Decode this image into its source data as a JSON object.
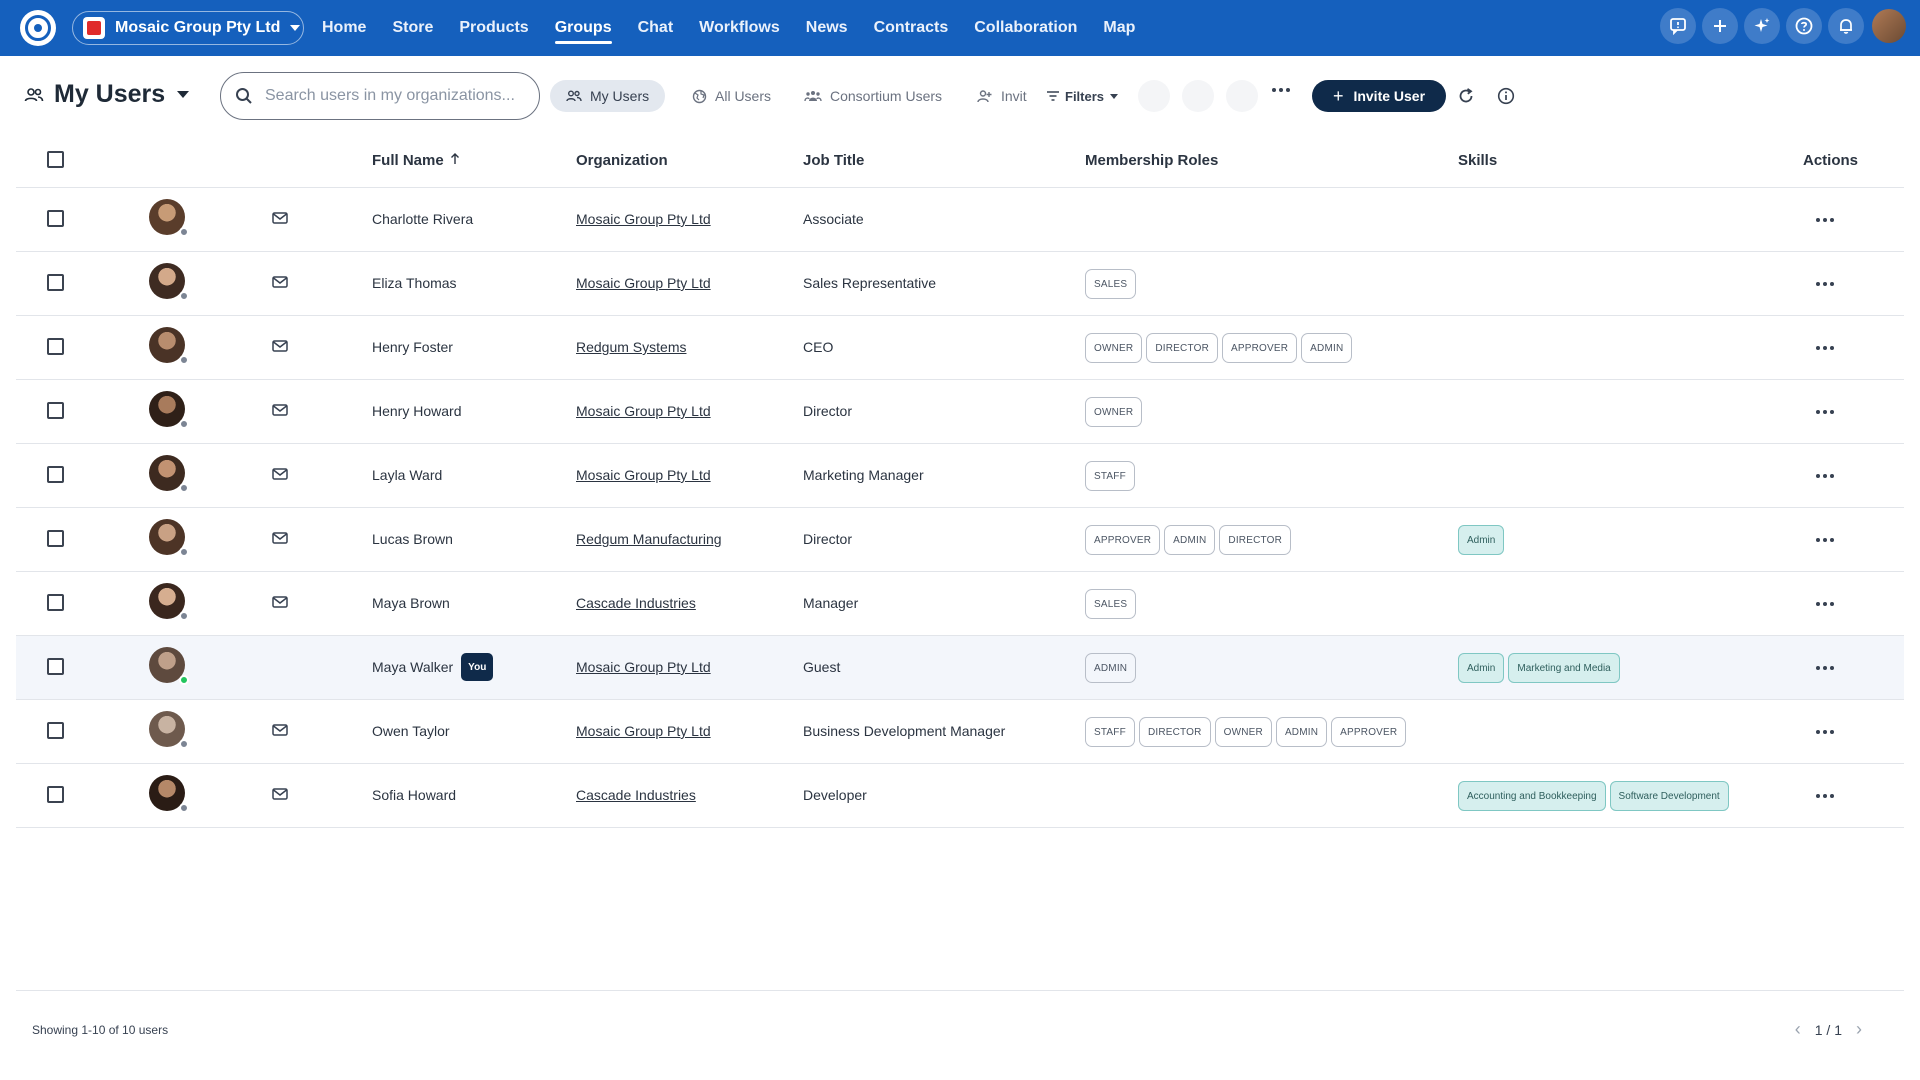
{
  "topbar": {
    "org_name": "Mosaic Group Pty Ltd",
    "nav": [
      "Home",
      "Store",
      "Products",
      "Groups",
      "Chat",
      "Workflows",
      "News",
      "Contracts",
      "Collaboration",
      "Map"
    ],
    "active_nav": "Groups",
    "icons": [
      "feedback-icon",
      "plus-icon",
      "sparkle-icon",
      "help-icon",
      "bell-icon"
    ]
  },
  "toolbar": {
    "title": "My Users",
    "search_placeholder": "Search users in my organizations...",
    "segments": {
      "my_users": "My Users",
      "all_users": "All Users",
      "consortium_users": "Consortium Users",
      "invites": "Invit"
    },
    "filters_label": "Filters",
    "invite_label": "Invite User"
  },
  "table": {
    "headers": {
      "full_name": "Full Name",
      "organization": "Organization",
      "job_title": "Job Title",
      "membership_roles": "Membership Roles",
      "skills": "Skills",
      "actions": "Actions"
    },
    "rows": [
      {
        "name": "Charlotte Rivera",
        "org": "Mosaic Group Pty Ltd",
        "job": "Associate",
        "roles": [],
        "skills": [],
        "you": false,
        "online": false,
        "mail": true
      },
      {
        "name": "Eliza Thomas",
        "org": "Mosaic Group Pty Ltd",
        "job": "Sales Representative",
        "roles": [
          "SALES"
        ],
        "skills": [],
        "you": false,
        "online": false,
        "mail": true
      },
      {
        "name": "Henry Foster",
        "org": "Redgum Systems",
        "job": "CEO",
        "roles": [
          "OWNER",
          "DIRECTOR",
          "APPROVER",
          "ADMIN"
        ],
        "skills": [],
        "you": false,
        "online": false,
        "mail": true
      },
      {
        "name": "Henry Howard",
        "org": "Mosaic Group Pty Ltd",
        "job": "Director",
        "roles": [
          "OWNER"
        ],
        "skills": [],
        "you": false,
        "online": false,
        "mail": true
      },
      {
        "name": "Layla Ward",
        "org": "Mosaic Group Pty Ltd",
        "job": "Marketing Manager",
        "roles": [
          "STAFF"
        ],
        "skills": [],
        "you": false,
        "online": false,
        "mail": true
      },
      {
        "name": "Lucas Brown",
        "org": "Redgum Manufacturing",
        "job": "Director",
        "roles": [
          "APPROVER",
          "ADMIN",
          "DIRECTOR"
        ],
        "skills": [
          "Admin"
        ],
        "you": false,
        "online": false,
        "mail": true
      },
      {
        "name": "Maya Brown",
        "org": "Cascade Industries",
        "job": "Manager",
        "roles": [
          "SALES"
        ],
        "skills": [],
        "you": false,
        "online": false,
        "mail": true
      },
      {
        "name": "Maya Walker",
        "org": "Mosaic Group Pty Ltd",
        "job": "Guest",
        "roles": [
          "ADMIN"
        ],
        "skills": [
          "Admin",
          "Marketing and Media"
        ],
        "you": true,
        "online": true,
        "mail": false
      },
      {
        "name": "Owen Taylor",
        "org": "Mosaic Group Pty Ltd",
        "job": "Business Development Manager",
        "roles": [
          "STAFF",
          "DIRECTOR",
          "OWNER",
          "ADMIN",
          "APPROVER"
        ],
        "skills": [],
        "you": false,
        "online": false,
        "mail": true
      },
      {
        "name": "Sofia Howard",
        "org": "Cascade Industries",
        "job": "Developer",
        "roles": [],
        "skills": [
          "Accounting and Bookkeeping",
          "Software Development"
        ],
        "you": false,
        "online": false,
        "mail": true
      }
    ],
    "you_label": "You"
  },
  "footer": {
    "showing": "Showing 1-10 of 10 users",
    "page": "1 / 1"
  },
  "colors": {
    "topbar": "#1560bd",
    "primary_button": "#0f2a4a",
    "skill_bg": "#d6efee",
    "online": "#22c55e"
  }
}
